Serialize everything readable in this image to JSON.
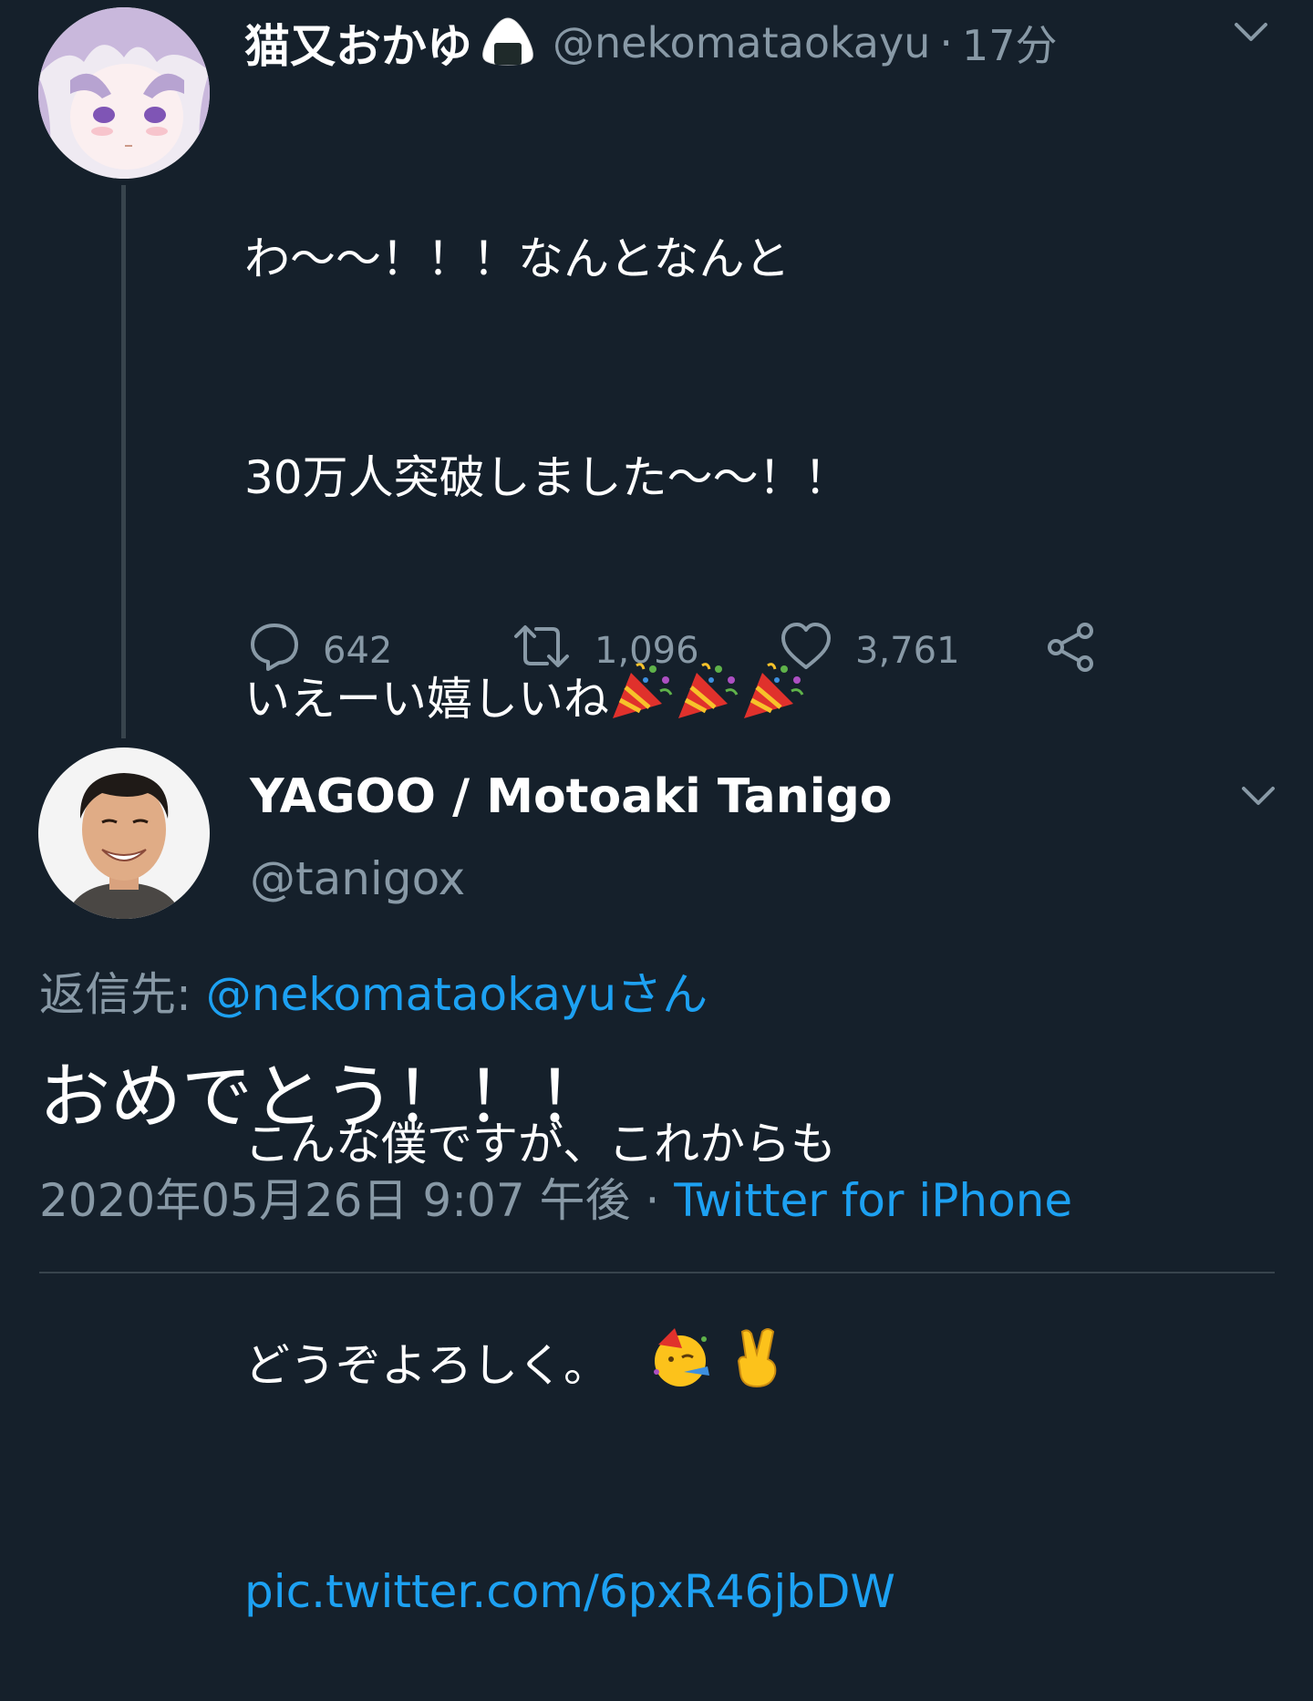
{
  "tweet1": {
    "display_name": "猫又おかゆ",
    "handle": "@nekomataokayu",
    "separator": "·",
    "time": "17分",
    "text_line1": "わ〜〜！！！なんとなんと",
    "text_line2": "30万人突破しました〜〜！！",
    "text_line3": "いえーい嬉しいね",
    "text_line5": "こんな僕ですが、これからも",
    "text_line6": "どうぞよろしく。",
    "link": "pic.twitter.com/6pxR46jbDW",
    "replies": "642",
    "retweets": "1,096",
    "likes": "3,761"
  },
  "tweet2": {
    "display_name": "YAGOO / Motoaki Tanigo",
    "handle": "@tanigox",
    "reply_prefix": "返信先: ",
    "reply_to": "@nekomataokayu",
    "reply_suffix": "さん",
    "text": "おめでとう！！！",
    "timestamp": "2020年05月26日 9:07 午後",
    "separator": " · ",
    "source": "Twitter for iPhone"
  },
  "colors": {
    "background": "#15202b",
    "muted": "#8899a6",
    "link": "#1da1f2",
    "divider": "#38444d"
  },
  "icons": [
    "onigiri-icon",
    "party-popper-icon",
    "partying-face-icon",
    "victory-hand-icon",
    "reply-icon",
    "retweet-icon",
    "like-icon",
    "share-icon",
    "chevron-down-icon"
  ]
}
